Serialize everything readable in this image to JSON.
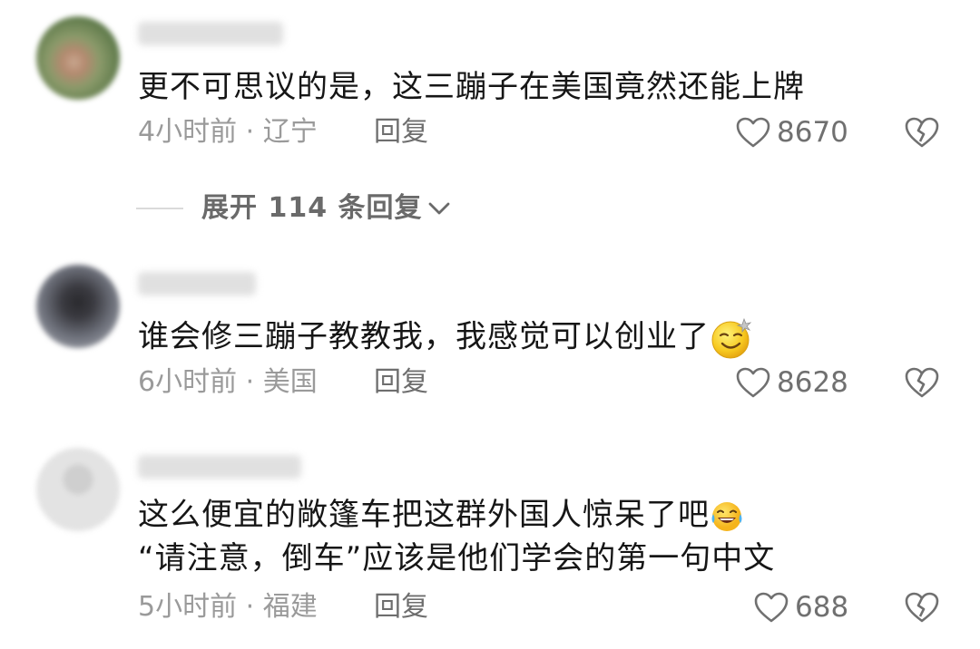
{
  "comments": [
    {
      "text": "更不可思议的是，这三蹦子在美国竟然还能上牌",
      "meta": "4小时前 · 辽宁",
      "reply_label": "回复",
      "likes": "8670"
    },
    {
      "text": "谁会修三蹦子教教我，我感觉可以创业了",
      "emoji": "dazed-smile-emoji",
      "meta": "6小时前 · 美国",
      "reply_label": "回复",
      "likes": "8628"
    },
    {
      "text_line1": "这么便宜的敞篷车把这群外国人惊呆了吧",
      "emoji": "laughing-tears-emoji",
      "text_line2": "“请注意，倒车”应该是他们学会的第一句中文",
      "meta": "5小时前 · 福建",
      "reply_label": "回复",
      "likes": "688"
    }
  ],
  "expand_replies": {
    "label": "展开 114 条回复"
  },
  "icons": {
    "like": "heart-outline-icon",
    "dislike": "broken-heart-icon",
    "expand": "chevron-down-icon"
  },
  "colors": {
    "text": "#161616",
    "meta": "#9a9a9a",
    "icon": "#707070"
  }
}
